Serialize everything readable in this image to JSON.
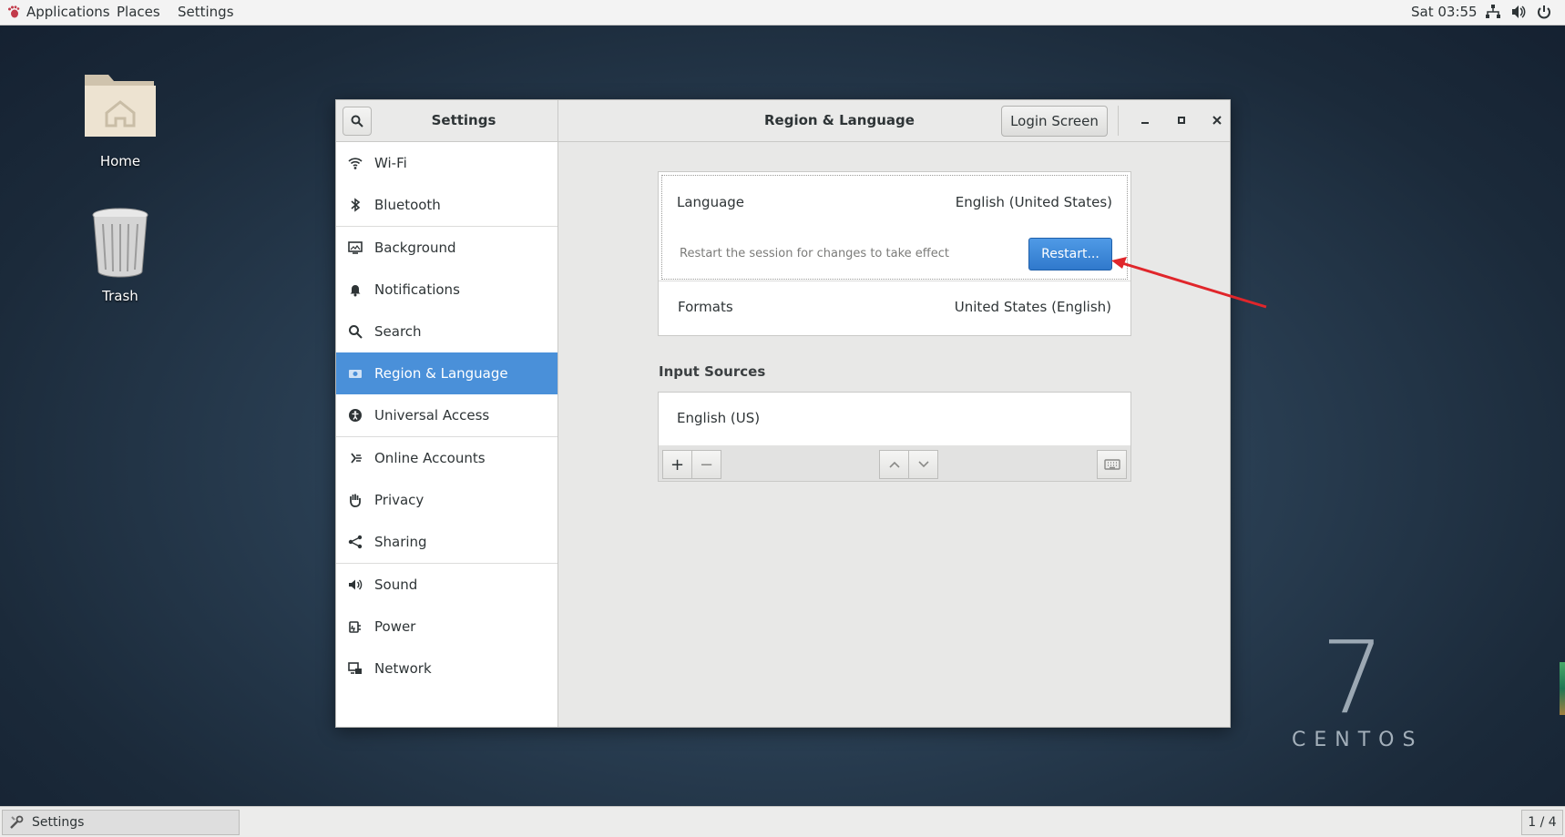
{
  "topbar": {
    "applications": "Applications",
    "places": "Places",
    "settings": "Settings",
    "clock": "Sat 03:55",
    "tray_icons": [
      "network-icon",
      "volume-icon",
      "power-icon"
    ]
  },
  "desktop": {
    "home_label": "Home",
    "trash_label": "Trash",
    "watermark_number": "7",
    "watermark_word": "CENTOS"
  },
  "window": {
    "sidebar_title": "Settings",
    "panel_title": "Region & Language",
    "login_screen_button": "Login Screen",
    "controls": [
      "minimize-icon",
      "maximize-icon",
      "close-icon"
    ]
  },
  "sidebar": {
    "items": [
      {
        "label": "Wi-Fi",
        "icon": "wifi-icon"
      },
      {
        "label": "Bluetooth",
        "icon": "bluetooth-icon"
      },
      {
        "label": "Background",
        "icon": "background-icon"
      },
      {
        "label": "Notifications",
        "icon": "bell-icon"
      },
      {
        "label": "Search",
        "icon": "search-icon"
      },
      {
        "label": "Region & Language",
        "icon": "camera-icon",
        "active": true
      },
      {
        "label": "Universal Access",
        "icon": "accessibility-icon"
      },
      {
        "label": "Online Accounts",
        "icon": "online-accounts-icon"
      },
      {
        "label": "Privacy",
        "icon": "hand-icon"
      },
      {
        "label": "Sharing",
        "icon": "share-icon"
      },
      {
        "label": "Sound",
        "icon": "speaker-icon"
      },
      {
        "label": "Power",
        "icon": "power-plug-icon"
      },
      {
        "label": "Network",
        "icon": "network-icon"
      }
    ]
  },
  "region": {
    "language_label": "Language",
    "language_value": "English (United States)",
    "restart_hint": "Restart the session for changes to take effect",
    "restart_button": "Restart...",
    "formats_label": "Formats",
    "formats_value": "United States (English)"
  },
  "input_sources": {
    "heading": "Input Sources",
    "items": [
      "English (US)"
    ],
    "add_label": "+",
    "remove_label": "−"
  },
  "taskbar": {
    "window_label": "Settings",
    "workspace": "1 / 4"
  },
  "colors": {
    "accent": "#4a90d9",
    "restart_button": "#3079cc",
    "annotation_arrow": "#e0262b"
  }
}
